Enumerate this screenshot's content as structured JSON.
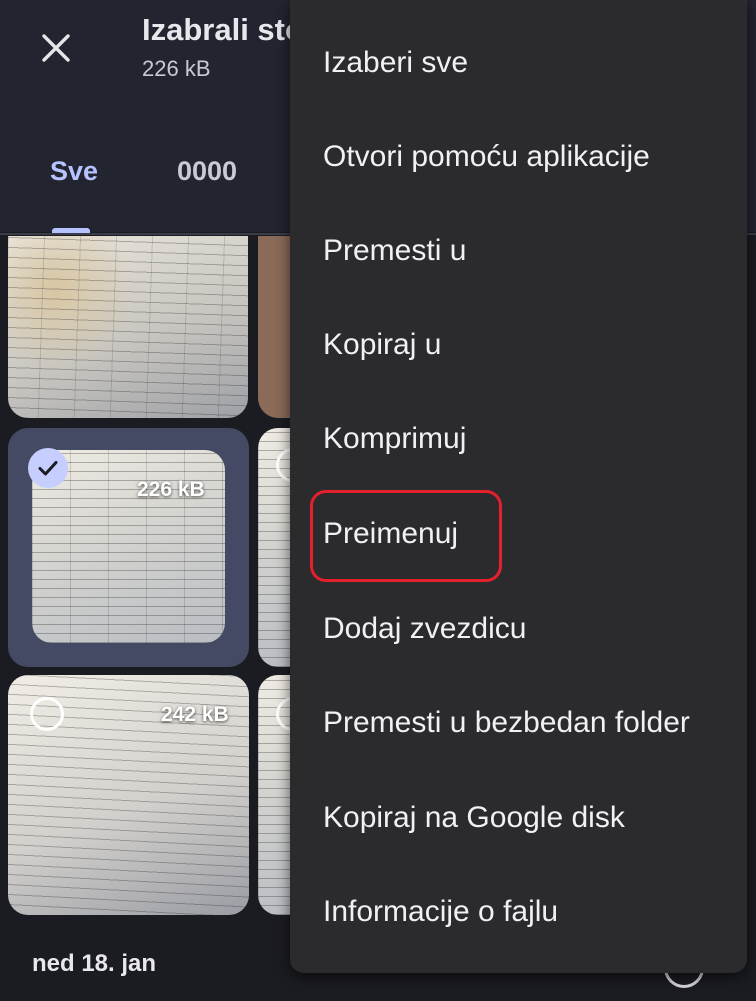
{
  "header": {
    "title": "Izabrali sto",
    "subtitle": "226 kB",
    "tabs": [
      {
        "label": "Sve",
        "active": true
      },
      {
        "label": "0000",
        "active": false
      }
    ]
  },
  "grid": {
    "tiles": [
      {
        "size_label": "",
        "selected": false
      },
      {
        "size_label": "226 kB",
        "selected": true
      },
      {
        "size_label": "242 kB",
        "selected": false
      }
    ],
    "date_label": "ned 18. jan"
  },
  "menu": {
    "items": [
      {
        "label": "Izaberi sve"
      },
      {
        "label": "Otvori pomoću aplikacije"
      },
      {
        "label": "Premesti u"
      },
      {
        "label": "Kopiraj u"
      },
      {
        "label": "Komprimuj"
      },
      {
        "label": "Preimenuj"
      },
      {
        "label": "Dodaj zvezdicu"
      },
      {
        "label": "Premesti u bezbedan folder"
      },
      {
        "label": "Kopiraj na Google disk"
      },
      {
        "label": "Informacije o fajlu"
      }
    ],
    "highlighted_item": "Preimenuj",
    "highlight_color": "#e3202b"
  },
  "colors": {
    "accent": "#b7c3ff",
    "app_bar": "#22242f",
    "menu_background": "#2b2b2d",
    "selected_check": "#c5ceff"
  },
  "icons": {
    "close": "close-icon",
    "check": "check-icon",
    "select_circle": "select-circle-icon"
  }
}
